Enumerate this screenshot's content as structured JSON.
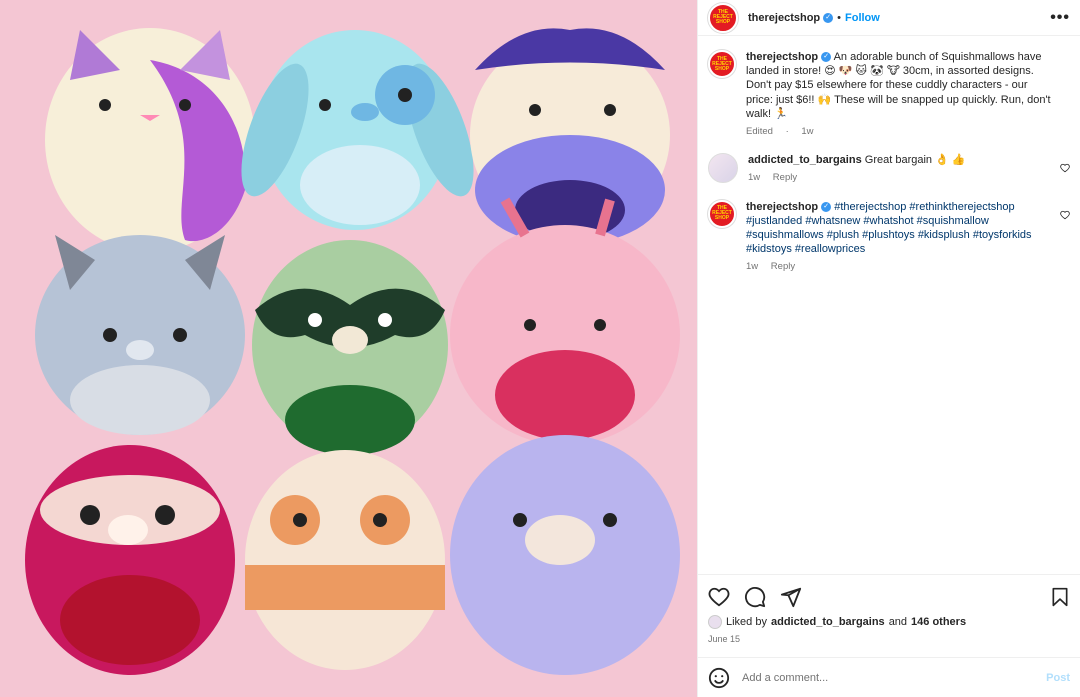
{
  "post_image": {
    "alt": ""
  },
  "header": {
    "avatar_text": "THE REJECT SHOP",
    "username": "therejectshop",
    "separator": "•",
    "follow_label": "Follow",
    "more_label": "•••"
  },
  "caption": {
    "username": "therejectshop",
    "text": "An adorable bunch of Squishmallows have landed in store! 😍 🐶 🐱 🐼 🐮 30cm, in assorted designs. Don't pay $15 elsewhere for these cuddly characters - our price: just $6!! 🙌 These will be snapped up quickly. Run, don't walk! 🏃",
    "edited": "Edited",
    "time": "1w"
  },
  "comments": [
    {
      "username": "addicted_to_bargains",
      "text": "Great bargain 👌 👍",
      "time": "1w",
      "reply": "Reply"
    },
    {
      "username": "therejectshop",
      "hashtags": "#therejectshop #rethinktherejectshop #justlanded #whatsnew #whatshot #squishmallow #squishmallows #plush #plushtoys #kidsplush #toysforkids #kidstoys #reallowprices",
      "time": "1w",
      "reply": "Reply"
    }
  ],
  "likes": {
    "prefix": "Liked by",
    "user": "addicted_to_bargains",
    "and": "and",
    "others": "146 others"
  },
  "date": "June 15",
  "add_comment": {
    "placeholder": "Add a comment...",
    "post_label": "Post"
  },
  "colors": {
    "accent": "#0095f6",
    "brand_red": "#e31b23",
    "photo_bg": "#f4c6d3"
  }
}
